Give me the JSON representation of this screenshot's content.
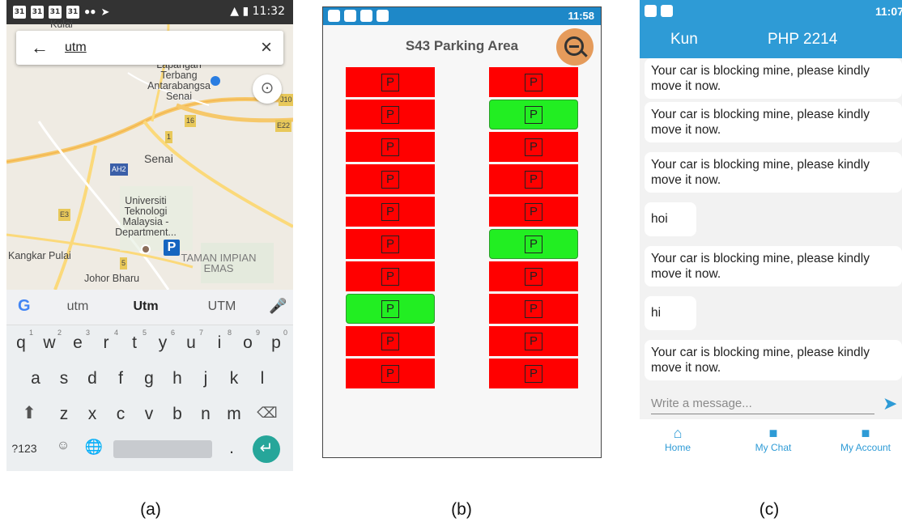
{
  "captions": [
    "(a)",
    "(b)",
    "(c)"
  ],
  "panel_a": {
    "status_time": "11:32",
    "status_calendar_day": "31",
    "search": {
      "value": "utm"
    },
    "map_labels": [
      "Kulai",
      "Lapangan Terbang Antarabangsa Senai",
      "Senai",
      "Universiti Teknologi Malaysia - Department...",
      "Kangkar Pulai",
      "TAMAN IMPIAN EMAS",
      "Johor Bharu",
      "AH2",
      "E3",
      "16",
      "1",
      "5",
      "J10",
      "E22"
    ],
    "map_pin_label": "P",
    "suggestions": [
      "utm",
      "Utm",
      "UTM"
    ],
    "keyboard": {
      "row1": [
        "q",
        "w",
        "e",
        "r",
        "t",
        "y",
        "u",
        "i",
        "o",
        "p"
      ],
      "row1_hints": [
        "1",
        "2",
        "3",
        "4",
        "5",
        "6",
        "7",
        "8",
        "9",
        "0"
      ],
      "row2": [
        "a",
        "s",
        "d",
        "f",
        "g",
        "h",
        "j",
        "k",
        "l"
      ],
      "row3": [
        "z",
        "x",
        "c",
        "v",
        "b",
        "n",
        "m"
      ],
      "symbols_key": "?123",
      "period_key": "."
    },
    "icons": [
      "back-arrow-icon",
      "clear-icon",
      "my-location-icon",
      "google-icon",
      "mic-icon",
      "shift-icon",
      "backspace-icon",
      "emoji-icon",
      "globe-icon",
      "enter-icon"
    ]
  },
  "panel_b": {
    "status_time": "11:58",
    "title": "S43 Parking Area",
    "slot_label": "P",
    "left_column": [
      "occupied",
      "occupied",
      "occupied",
      "occupied",
      "occupied",
      "occupied",
      "occupied",
      "free",
      "occupied",
      "occupied"
    ],
    "right_column": [
      "occupied",
      "free",
      "occupied",
      "occupied",
      "occupied",
      "free",
      "occupied",
      "occupied",
      "occupied",
      "occupied"
    ],
    "colors": {
      "occupied": "#ff0000",
      "free": "#22ee22",
      "accent": "#e59b5b"
    },
    "icons": [
      "zoom-out-icon"
    ]
  },
  "panel_c": {
    "status_time": "11:07",
    "header_left": "Kun",
    "header_title": "PHP 2214",
    "messages": [
      "Your car is blocking mine, please kindly move it now.",
      "Your car is blocking mine, please kindly move it now.",
      "Your car is blocking mine, please kindly move it now.",
      "hoi",
      "Your car is blocking mine, please kindly move it now.",
      "hi",
      "Your car is blocking mine, please kindly move it now."
    ],
    "composer_placeholder": "Write a message...",
    "nav": [
      "Home",
      "My Chat",
      "My Account"
    ],
    "colors": {
      "primary": "#2e9bd6"
    },
    "icons": [
      "send-icon",
      "home-icon",
      "chat-icon",
      "account-icon"
    ]
  }
}
